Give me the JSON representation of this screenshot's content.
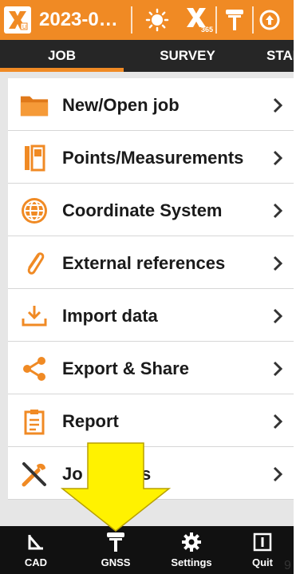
{
  "titlebar": {
    "job_title": "2023-0…",
    "accent_color": "#f08a24"
  },
  "tabs": [
    {
      "label": "JOB",
      "active": true
    },
    {
      "label": "SURVEY",
      "active": false
    },
    {
      "label": "STAK",
      "active": false
    }
  ],
  "menu": {
    "items": [
      {
        "label": "New/Open job",
        "icon": "folder-icon"
      },
      {
        "label": "Points/Measurements",
        "icon": "points-icon"
      },
      {
        "label": "Coordinate System",
        "icon": "globe-icon"
      },
      {
        "label": "External references",
        "icon": "paperclip-icon"
      },
      {
        "label": "Import data",
        "icon": "import-icon"
      },
      {
        "label": "Export & Share",
        "icon": "share-icon"
      },
      {
        "label": "Report",
        "icon": "clipboard-icon"
      },
      {
        "label": "Job Utilities",
        "visible_label": "Jo          es",
        "icon": "tools-icon"
      }
    ]
  },
  "bottombar": {
    "items": [
      {
        "label": "CAD",
        "icon": "cad-icon"
      },
      {
        "label": "GNSS",
        "icon": "gnss-icon"
      },
      {
        "label": "Settings",
        "icon": "gear-icon"
      },
      {
        "label": "Quit",
        "icon": "quit-icon"
      }
    ]
  },
  "edge_digit": "9",
  "annotation": {
    "color": "#fff200",
    "icon": "yellow-arrow-down-icon"
  }
}
